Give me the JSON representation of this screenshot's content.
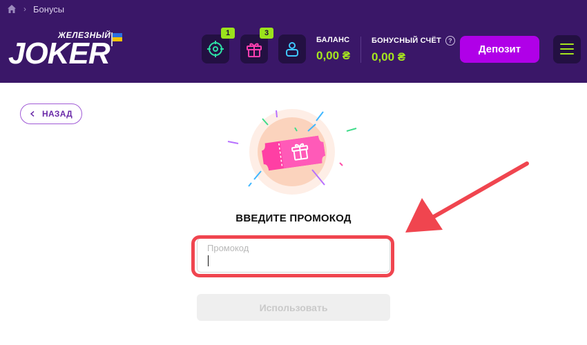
{
  "breadcrumb": {
    "current": "Бонусы"
  },
  "logo": {
    "subtitle": "ЖЕЛЕЗНЫЙ",
    "name": "JOKER"
  },
  "header": {
    "missions_badge": "1",
    "gifts_badge": "3",
    "balance_label": "БАЛАНС",
    "balance_value": "0,00 ₴",
    "bonus_label": "БОНУСНЫЙ СЧЁТ",
    "bonus_help": "?",
    "bonus_value": "0,00 ₴",
    "deposit_label": "Депозит"
  },
  "back": {
    "label": "НАЗАД"
  },
  "promo": {
    "title": "ВВЕДИТЕ ПРОМОКОД",
    "placeholder": "Промокод",
    "value": "",
    "submit_label": "Использовать"
  },
  "colors": {
    "header_bg": "#3a1768",
    "accent_green": "#a6e61e",
    "deposit_purple": "#b000e8",
    "highlight_red": "#f0454f"
  },
  "icons": [
    "home-icon",
    "target-icon",
    "gift-icon",
    "user-icon",
    "menu-icon",
    "chevron-left-icon"
  ]
}
